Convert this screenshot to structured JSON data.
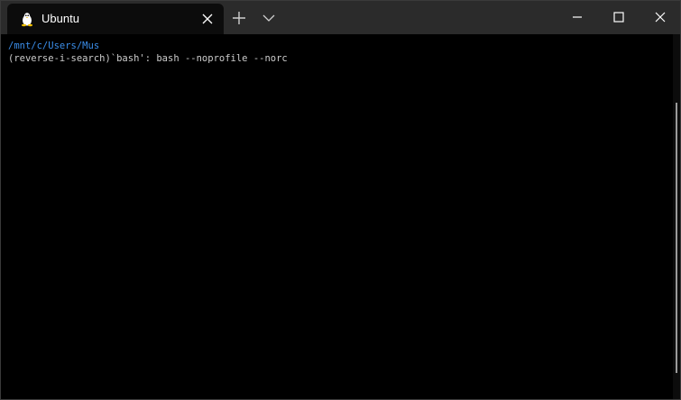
{
  "window": {
    "tab": {
      "title": "Ubuntu",
      "icon": "linux-penguin-icon"
    },
    "controls": {
      "new_tab_icon": "plus-icon",
      "dropdown_icon": "chevron-down-icon",
      "minimize_icon": "minimize-icon",
      "maximize_icon": "maximize-icon",
      "close_icon": "close-icon"
    }
  },
  "terminal": {
    "prompt_path": "/mnt/c/Users/Mus",
    "search_line": "(reverse-i-search)`bash': bash --noprofile --norc"
  },
  "colors": {
    "titlebar": "#2b2b2b",
    "tab": "#0c0c0c",
    "terminal_bg": "#000000",
    "path": "#3b8eea",
    "text": "#cccccc"
  }
}
